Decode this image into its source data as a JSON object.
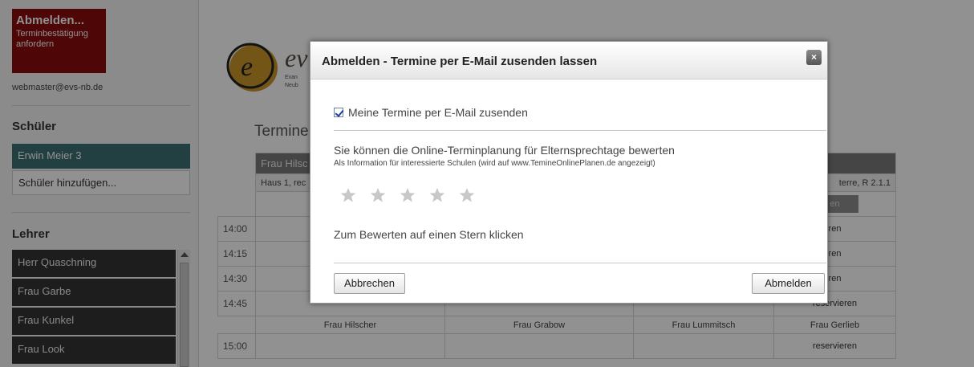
{
  "sidebar": {
    "logout_title": "Abmelden...",
    "logout_sub": "Terminbestätigung anfordern",
    "user_email": "webmaster@evs-nb.de",
    "students_title": "Schüler",
    "students": [
      "Erwin Meier 3"
    ],
    "add_student_label": "Schüler hinzufügen...",
    "teachers_title": "Lehrer",
    "teachers": [
      "Herr Quaschning",
      "Frau Garbe",
      "Frau Kunkel",
      "Frau Look"
    ]
  },
  "main": {
    "brand_text": "ev",
    "brand_sub1": "Evan",
    "brand_sub2": "Neub",
    "heading": "Termine",
    "schedule": {
      "header_visible": [
        "Frau Hilsc",
        "",
        "",
        ""
      ],
      "rooms": [
        "Haus 1, rec",
        "",
        "",
        "terre, R 2.1.1"
      ],
      "grey_btn_last": "en",
      "times": [
        "14:00",
        "14:15",
        "14:30",
        "14:45",
        "15:00"
      ],
      "reserve_partial": "ren",
      "reserve_label": "reservieren",
      "teacher_names": [
        "Frau Hilscher",
        "Frau Grabow",
        "Frau Lummitsch",
        "Frau Gerlieb"
      ]
    }
  },
  "dialog": {
    "title": "Abmelden - Termine per E-Mail zusenden lassen",
    "close_symbol": "×",
    "checkbox_label": "Meine Termine per E-Mail zusenden",
    "checkbox_checked": true,
    "rate_title": "Sie können die Online-Terminplanung für Elternsprechtage bewerten",
    "rate_subtitle": "Als Information für interessierte Schulen (wird auf www.TemineOnlinePlanen.de angezeigt)",
    "star_count": 5,
    "rate_hint": "Zum Bewerten auf einen Stern klicken",
    "cancel_label": "Abbrechen",
    "logout_label": "Abmelden"
  },
  "colors": {
    "logout_red": "#8c0b0b",
    "active_student": "#3d6f73",
    "teacher_item": "#333333",
    "star_grey": "#c8c8c8"
  }
}
